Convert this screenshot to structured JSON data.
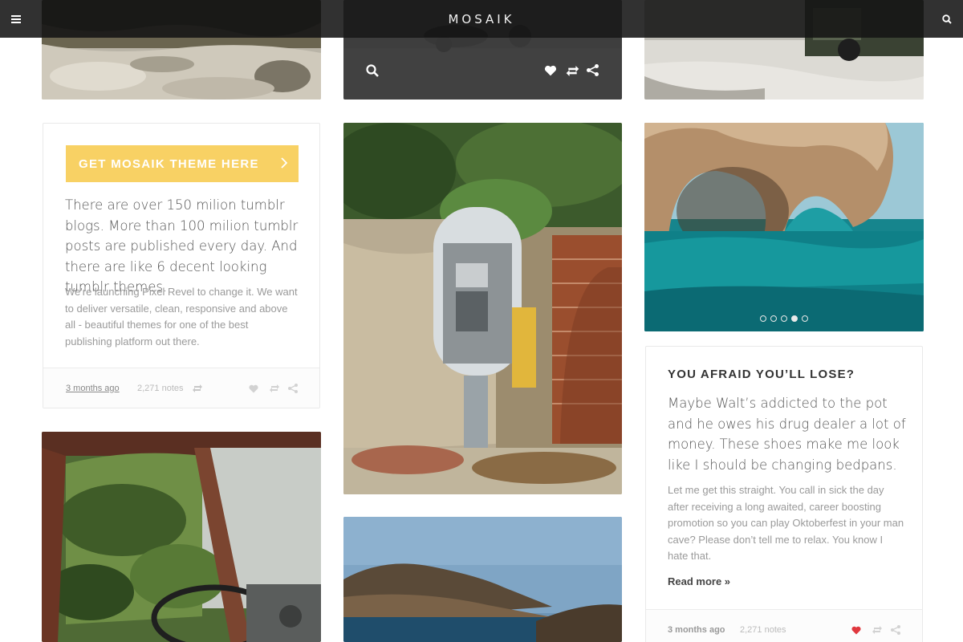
{
  "header": {
    "brand": "MOSAIK"
  },
  "cta_card": {
    "button_label": "GET MOSAIK THEME HERE",
    "lead": "There are over 150 milion tumblr blogs. More than 100 milion tumblr posts are published every day. And there are like 6 decent looking tumblr themes.",
    "body": "We're launching Pixel Revel to change it. We want to deliver versatile, clean, responsive and above all - beautiful themes for one of the best publishing platform out there.",
    "date": "3 months ago",
    "notes": "2,271 notes"
  },
  "text_post": {
    "title": "YOU AFRAID YOU’LL LOSE?",
    "lead": "Maybe Walt’s addicted to the pot and he owes his drug dealer a lot of money. These shoes make me look like I should be changing bedpans.",
    "body": "Let me get this straight. You call in sick the day after receiving a long awaited, career boosting promotion so you can play Oktoberfest in your man cave? Please don’t tell me to relax. You know I hate that.",
    "read_more": "Read more »",
    "date": "3 months ago",
    "notes": "2,271 notes"
  },
  "slider": {
    "slide_count": 5,
    "active_index": 3
  },
  "colors": {
    "accent": "#f8d164",
    "liked": "#e0383e"
  },
  "icons": [
    "menu-icon",
    "search-icon",
    "heart-icon",
    "reblog-icon",
    "share-icon",
    "chevron-right-icon",
    "zoom-icon"
  ]
}
